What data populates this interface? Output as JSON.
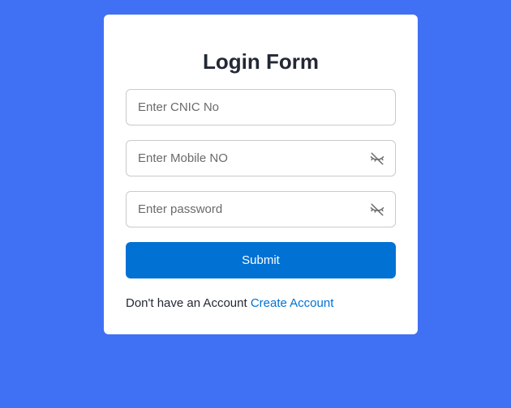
{
  "form": {
    "title": "Login Form",
    "cnic_placeholder": "Enter CNIC No",
    "mobile_placeholder": "Enter Mobile NO",
    "password_placeholder": "Enter password",
    "submit_label": "Submit",
    "signup_text": "Don't have an Account",
    "signup_link": "Create Account"
  },
  "icons": {
    "mobile_toggle": "eye-slash-icon",
    "password_toggle": "eye-slash-icon"
  },
  "colors": {
    "background": "#4070f4",
    "accent": "#0171d3",
    "text": "#232836"
  }
}
